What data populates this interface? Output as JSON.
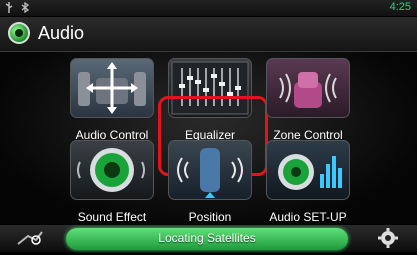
{
  "status": {
    "time": "4:25",
    "icons": [
      "usb-icon",
      "bluetooth-icon"
    ]
  },
  "header": {
    "title": "Audio",
    "icon": "speaker-icon"
  },
  "tiles": [
    {
      "label": "Audio Control",
      "icon": "audio-control-icon"
    },
    {
      "label": "Equalizer",
      "icon": "equalizer-icon",
      "selected": true
    },
    {
      "label": "Zone Control",
      "icon": "zone-control-icon"
    },
    {
      "label": "Sound Effect",
      "icon": "speaker-icon"
    },
    {
      "label": "Position",
      "icon": "seat-position-icon"
    },
    {
      "label": "Audio SET-UP",
      "icon": "audio-setup-icon"
    }
  ],
  "footer": {
    "status_text": "Locating Satellites",
    "left_button_icon": "navigation-icon",
    "right_button_icon": "gear-icon"
  },
  "colors": {
    "accent_green": "#2fd27a",
    "selection_red": "#e3121f"
  }
}
